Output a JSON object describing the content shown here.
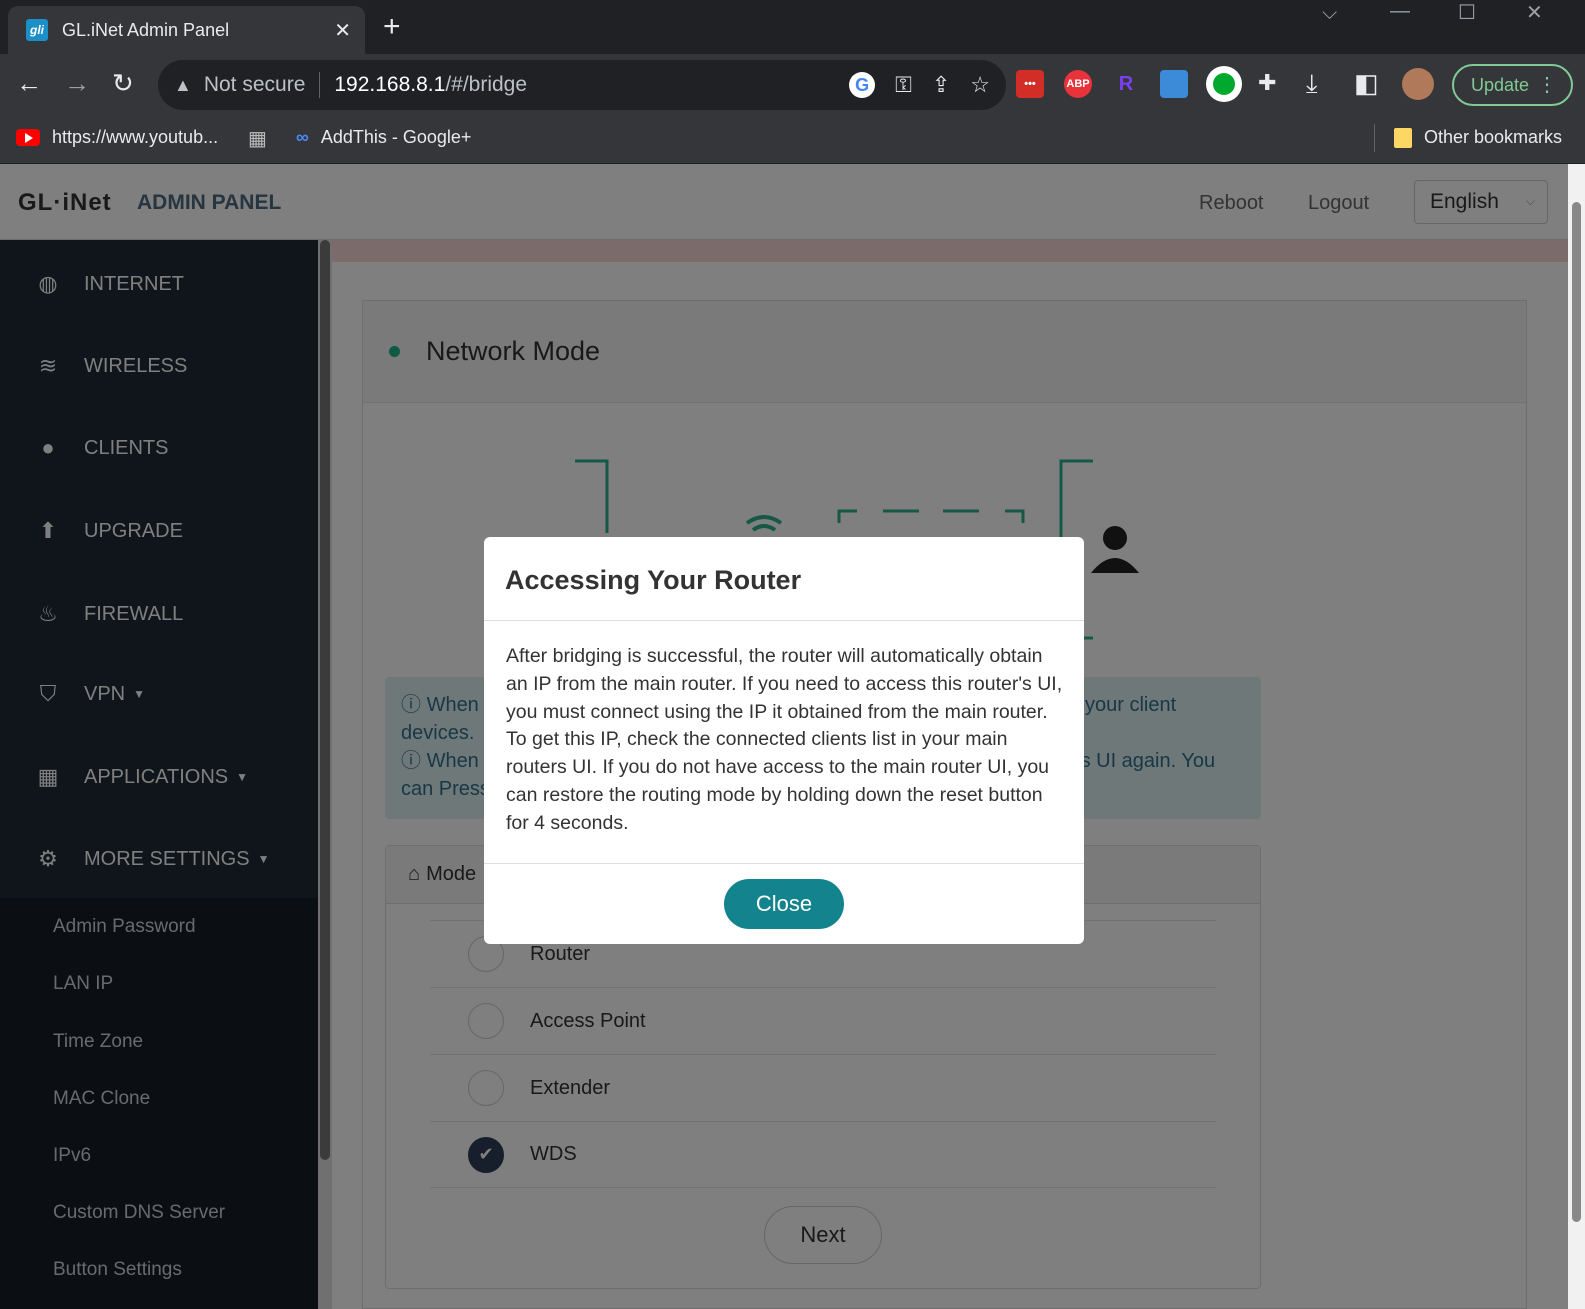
{
  "browser": {
    "tab_title": "GL.iNet Admin Panel",
    "tab_favicon_text": "gli",
    "security_label": "Not secure",
    "url_host": "192.168.8.1",
    "url_path": "/#/bridge",
    "update_label": "Update",
    "bookmarks": [
      {
        "label": "https://www.youtub..."
      },
      {
        "label": "AddThis - Google+"
      }
    ],
    "other_bookmarks": "Other bookmarks",
    "extensions": [
      {
        "name": "lastpass-icon",
        "text": "•••",
        "color": "#d32d27"
      },
      {
        "name": "adblock-plus-icon",
        "text": "ABP",
        "color": "#e8333b"
      },
      {
        "name": "r-extension-icon",
        "text": "R",
        "color": "#7b3ff2"
      },
      {
        "name": "rainbow-extension-icon",
        "text": "",
        "color": "#3c8bd9"
      },
      {
        "name": "evernote-icon",
        "text": "",
        "color": "#00a82d"
      }
    ]
  },
  "header": {
    "logo": "GL·iNet",
    "subtitle": "ADMIN PANEL",
    "reboot": "Reboot",
    "logout": "Logout",
    "language": "English"
  },
  "sidebar": {
    "items": [
      {
        "label": "INTERNET",
        "icon": "globe-icon"
      },
      {
        "label": "WIRELESS",
        "icon": "wifi-icon"
      },
      {
        "label": "CLIENTS",
        "icon": "user-icon"
      },
      {
        "label": "UPGRADE",
        "icon": "upgrade-icon"
      },
      {
        "label": "FIREWALL",
        "icon": "fire-icon"
      },
      {
        "label": "VPN",
        "icon": "shield-icon"
      },
      {
        "label": "APPLICATIONS",
        "icon": "grid-icon"
      },
      {
        "label": "MORE SETTINGS",
        "icon": "gear-icon"
      }
    ],
    "subitems": [
      "Admin Password",
      "LAN IP",
      "Time Zone",
      "MAC Clone",
      "IPv6",
      "Custom DNS Server",
      "Button Settings"
    ]
  },
  "main": {
    "panel_title": "Network Mode",
    "info_line1_left": "When y",
    "info_line1_right": "l your client",
    "info_line2_left": "devices.",
    "info_line3_left": "When y",
    "info_line3_right": "his UI again. You",
    "info_line4_left": "can Press",
    "info_line4_right": "e.",
    "mode_header": "Mode",
    "options": [
      {
        "label": "Router",
        "selected": false
      },
      {
        "label": "Access Point",
        "selected": false
      },
      {
        "label": "Extender",
        "selected": false
      },
      {
        "label": "WDS",
        "selected": true
      }
    ],
    "next": "Next"
  },
  "modal": {
    "title": "Accessing Your Router",
    "body": "After bridging is successful, the router will automatically obtain an IP from the main router. If you need to access this router's UI, you must connect using the IP it obtained from the main router. To get this IP, check the connected clients list in your main routers UI. If you do not have access to the main router UI, you can restore the routing mode by holding down the reset button for 4 seconds.",
    "close": "Close"
  },
  "colors": {
    "accent_teal": "#13848e",
    "sidebar_bg": "#1f2a37",
    "status_green": "#1fb38a",
    "diagram_teal": "#2bb08a"
  }
}
